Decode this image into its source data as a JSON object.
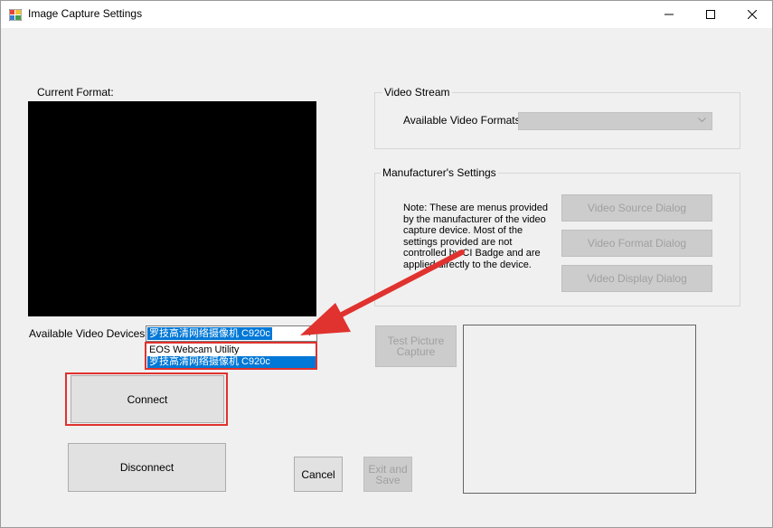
{
  "window": {
    "title": "Image Capture Settings"
  },
  "current_format": {
    "label": "Current Format:"
  },
  "video_stream": {
    "group_title": "Video Stream",
    "formats_label": "Available Video Formats:",
    "formats_value": ""
  },
  "manufacturer": {
    "group_title": "Manufacturer's Settings",
    "note": "Note:  These are menus provided by the manufacturer of the video capture device. Most of the settings provided are not controlled by CI Badge and are applied directly to the device.",
    "source_dialog": "Video Source Dialog",
    "format_dialog": "Video Format Dialog",
    "display_dialog": "Video Display Dialog"
  },
  "devices": {
    "label": "Available Video Devices:",
    "selected": "罗技高清网络摄像机 C920c",
    "options": [
      "EOS Webcam Utility",
      "罗技高清网络摄像机 C920c"
    ]
  },
  "buttons": {
    "test_capture_line1": "Test Picture",
    "test_capture_line2": "Capture",
    "connect": "Connect",
    "disconnect": "Disconnect",
    "cancel": "Cancel",
    "exit_line1": "Exit and",
    "exit_line2": "Save"
  },
  "colors": {
    "highlight": "#e0322e",
    "selection": "#0078d7"
  }
}
